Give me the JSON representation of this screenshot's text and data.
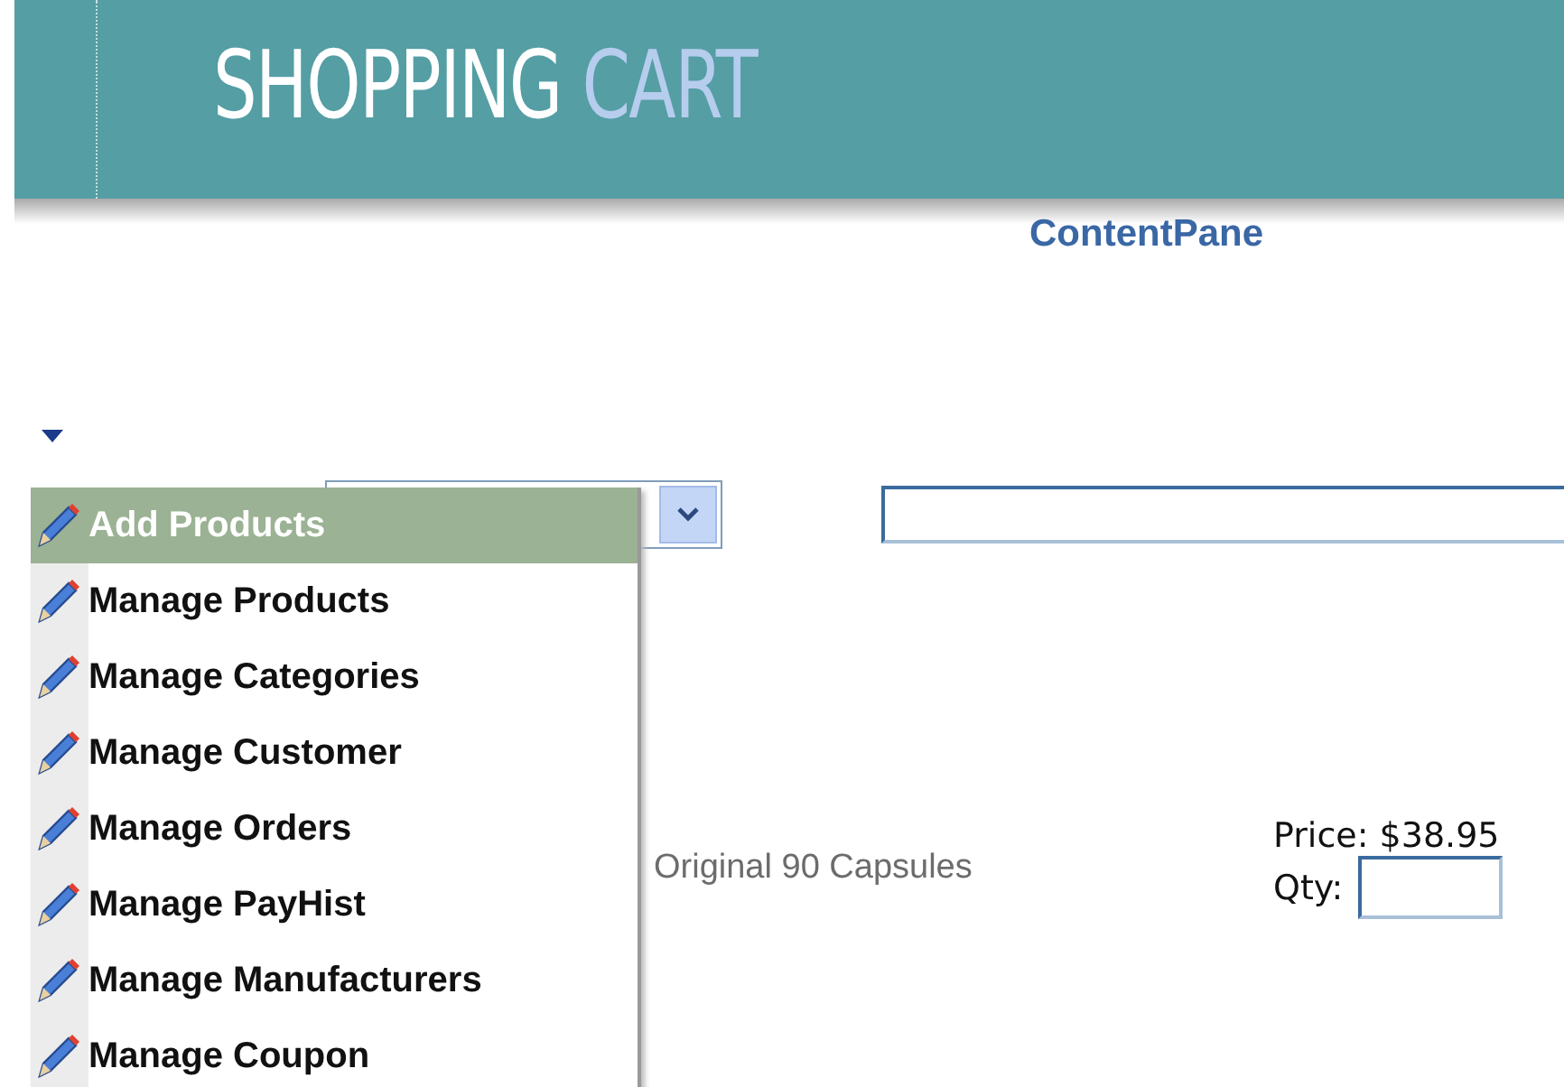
{
  "header": {
    "title_main": "SHOPPING",
    "title_accent": "CART"
  },
  "pane_title": "ContentPane",
  "menu": {
    "items": [
      {
        "label": "Add Products",
        "selected": true
      },
      {
        "label": "Manage Products",
        "selected": false
      },
      {
        "label": "Manage Categories",
        "selected": false
      },
      {
        "label": "Manage Customer",
        "selected": false
      },
      {
        "label": "Manage Orders",
        "selected": false
      },
      {
        "label": "Manage PayHist",
        "selected": false
      },
      {
        "label": "Manage Manufacturers",
        "selected": false
      },
      {
        "label": "Manage Coupon",
        "selected": false
      }
    ]
  },
  "product": {
    "description": "Original 90 Capsules",
    "price": "Price: $38.95",
    "qty_label": "Qty:"
  }
}
